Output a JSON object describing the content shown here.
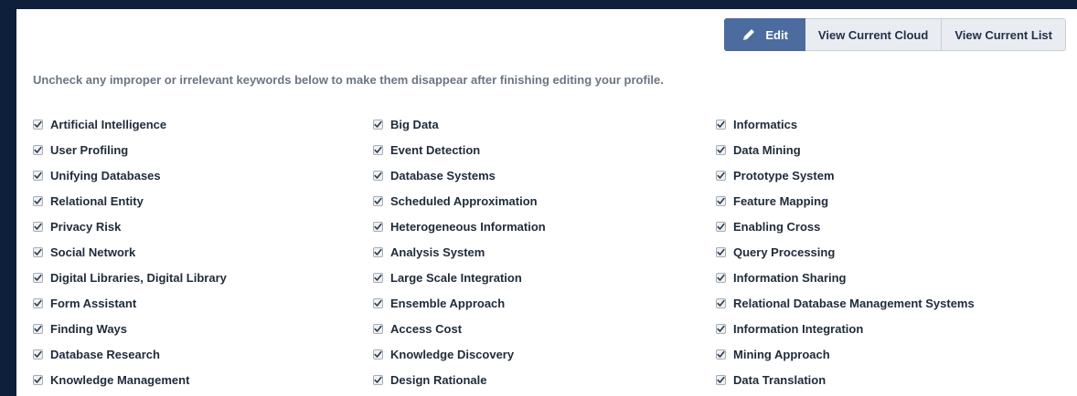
{
  "toolbar": {
    "edit_label": "Edit",
    "view_cloud_label": "View Current Cloud",
    "view_list_label": "View Current List"
  },
  "instructions": "Uncheck any improper or irrelevant keywords below to make them disappear after finishing editing your profile.",
  "keywords": [
    {
      "label": "Artificial Intelligence",
      "checked": true
    },
    {
      "label": "User Profiling",
      "checked": true
    },
    {
      "label": "Unifying Databases",
      "checked": true
    },
    {
      "label": "Relational Entity",
      "checked": true
    },
    {
      "label": "Privacy Risk",
      "checked": true
    },
    {
      "label": "Social Network",
      "checked": true
    },
    {
      "label": "Digital Libraries, Digital Library",
      "checked": true
    },
    {
      "label": "Form Assistant",
      "checked": true
    },
    {
      "label": "Finding Ways",
      "checked": true
    },
    {
      "label": "Database Research",
      "checked": true
    },
    {
      "label": "Knowledge Management",
      "checked": true
    },
    {
      "label": "Big Data",
      "checked": true
    },
    {
      "label": "Event Detection",
      "checked": true
    },
    {
      "label": "Database Systems",
      "checked": true
    },
    {
      "label": "Scheduled Approximation",
      "checked": true
    },
    {
      "label": "Heterogeneous Information",
      "checked": true
    },
    {
      "label": "Analysis System",
      "checked": true
    },
    {
      "label": "Large Scale Integration",
      "checked": true
    },
    {
      "label": "Ensemble Approach",
      "checked": true
    },
    {
      "label": "Access Cost",
      "checked": true
    },
    {
      "label": "Knowledge Discovery",
      "checked": true
    },
    {
      "label": "Design Rationale",
      "checked": true
    },
    {
      "label": "Informatics",
      "checked": true
    },
    {
      "label": "Data Mining",
      "checked": true
    },
    {
      "label": "Prototype System",
      "checked": true
    },
    {
      "label": "Feature Mapping",
      "checked": true
    },
    {
      "label": "Enabling Cross",
      "checked": true
    },
    {
      "label": "Query Processing",
      "checked": true
    },
    {
      "label": "Information Sharing",
      "checked": true
    },
    {
      "label": "Relational Database Management Systems",
      "checked": true
    },
    {
      "label": "Information Integration",
      "checked": true
    },
    {
      "label": "Mining Approach",
      "checked": true
    },
    {
      "label": "Data Translation",
      "checked": true
    }
  ],
  "colors": {
    "page_background": "#0e1f3b",
    "panel_background": "#ffffff",
    "edit_button": "#4c6b9e",
    "secondary_button": "#e9edf2"
  },
  "icons": {
    "edit": "pencil-icon",
    "checkbox": "checkmark-icon"
  }
}
